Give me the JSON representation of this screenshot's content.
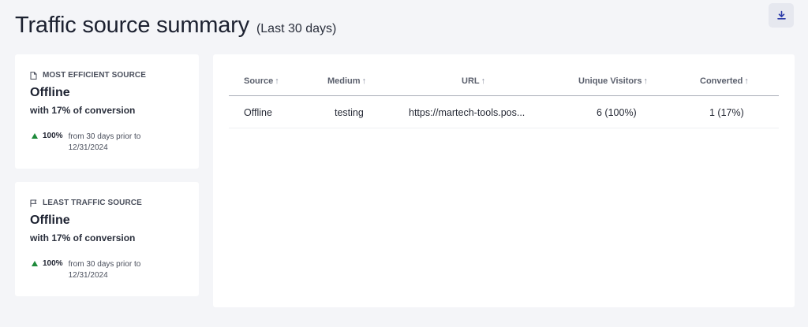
{
  "header": {
    "title": "Traffic source summary",
    "subtitle": "(Last 30 days)"
  },
  "toolbar": {
    "download_icon": "download-icon"
  },
  "cards": [
    {
      "icon": "file-icon",
      "heading": "MOST EFFICIENT SOURCE",
      "value": "Offline",
      "subtext": "with 17% of conversion",
      "change_pct": "100%",
      "change_text": "from 30 days prior to 12/31/2024"
    },
    {
      "icon": "flag-icon",
      "heading": "LEAST TRAFFIC SOURCE",
      "value": "Offline",
      "subtext": "with 17% of conversion",
      "change_pct": "100%",
      "change_text": "from 30 days prior to 12/31/2024"
    }
  ],
  "colors": {
    "trend_up": "#1e8a3a",
    "background": "#f4f5f8"
  },
  "table": {
    "columns": [
      "Source",
      "Medium",
      "URL",
      "Unique Visitors",
      "Converted"
    ],
    "sort_arrow": "↑",
    "rows": [
      [
        "Offline",
        "testing",
        "https://martech-tools.pos...",
        "6 (100%)",
        "1 (17%)"
      ]
    ]
  }
}
